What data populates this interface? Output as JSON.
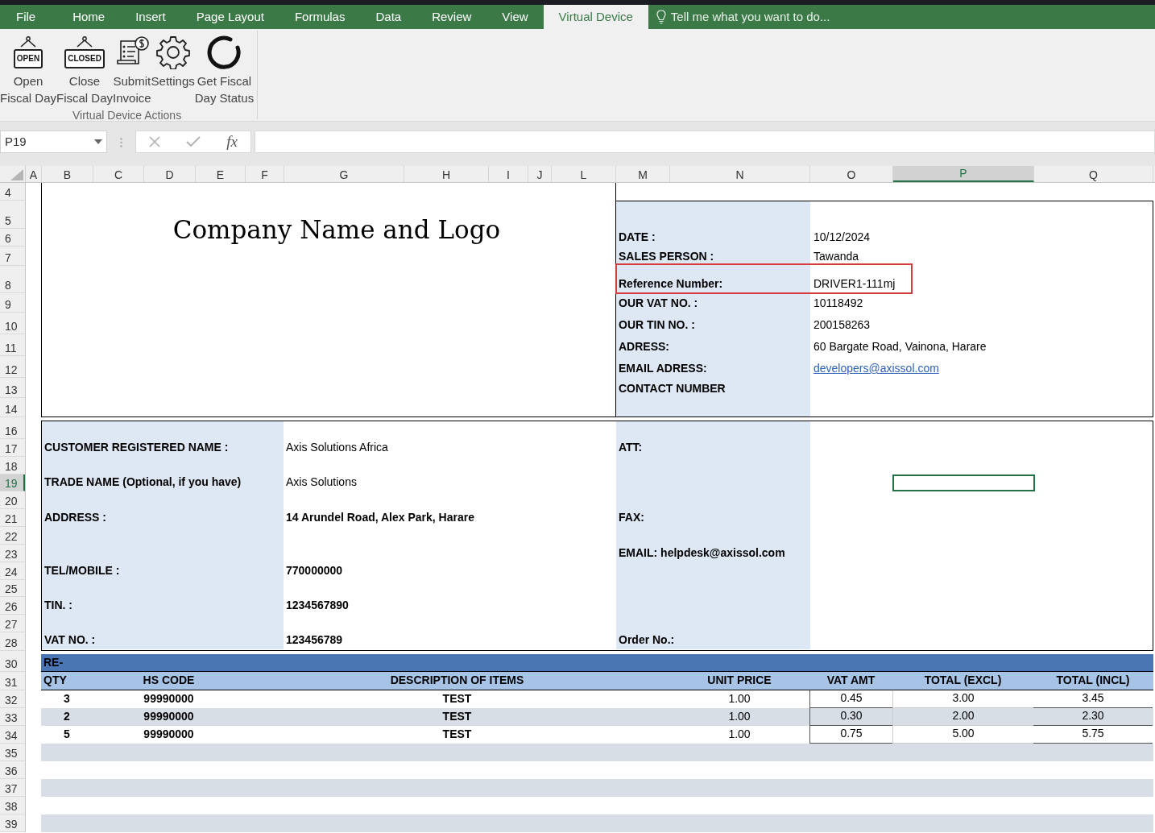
{
  "ribbon": {
    "tabs": [
      {
        "label": "File",
        "selected": false
      },
      {
        "label": "Home",
        "selected": false
      },
      {
        "label": "Insert",
        "selected": false
      },
      {
        "label": "Page Layout",
        "selected": false
      },
      {
        "label": "Formulas",
        "selected": false
      },
      {
        "label": "Data",
        "selected": false
      },
      {
        "label": "Review",
        "selected": false
      },
      {
        "label": "View",
        "selected": false
      },
      {
        "label": "Virtual Device",
        "selected": true
      }
    ],
    "tell_me": "Tell me what you want to do...",
    "buttons": [
      {
        "kind": "sign",
        "sign": "OPEN",
        "lines": [
          "Open",
          "Fiscal Day"
        ]
      },
      {
        "kind": "sign",
        "sign": "CLOSED",
        "lines": [
          "Close",
          "Fiscal Day"
        ]
      },
      {
        "kind": "invoice",
        "lines": [
          "Submit",
          "Invoice"
        ]
      },
      {
        "kind": "gear",
        "lines": [
          "Settings"
        ]
      },
      {
        "kind": "status",
        "lines": [
          "Get Fiscal",
          "Day Status"
        ]
      }
    ],
    "group_label": "Virtual Device Actions"
  },
  "formula_bar": {
    "name_box": "P19",
    "function_label": "fx"
  },
  "columns": [
    {
      "label": "A",
      "selected": false
    },
    {
      "label": "B",
      "selected": false
    },
    {
      "label": "C",
      "selected": false
    },
    {
      "label": "D",
      "selected": false
    },
    {
      "label": "E",
      "selected": false
    },
    {
      "label": "F",
      "selected": false
    },
    {
      "label": "G",
      "selected": false
    },
    {
      "label": "H",
      "selected": false
    },
    {
      "label": "I",
      "selected": false
    },
    {
      "label": "J",
      "selected": false
    },
    {
      "label": "L",
      "selected": false
    },
    {
      "label": "M",
      "selected": false
    },
    {
      "label": "N",
      "selected": false
    },
    {
      "label": "O",
      "selected": false
    },
    {
      "label": "P",
      "selected": true
    },
    {
      "label": "Q",
      "selected": false
    }
  ],
  "rows": [
    {
      "label": "4",
      "selected": false
    },
    {
      "label": "5",
      "selected": false
    },
    {
      "label": "6",
      "selected": false
    },
    {
      "label": "7",
      "selected": false
    },
    {
      "label": "8",
      "selected": false
    },
    {
      "label": "9",
      "selected": false
    },
    {
      "label": "10",
      "selected": false
    },
    {
      "label": "11",
      "selected": false
    },
    {
      "label": "12",
      "selected": false
    },
    {
      "label": "13",
      "selected": false
    },
    {
      "label": "14",
      "selected": false
    },
    {
      "label": "16",
      "selected": false
    },
    {
      "label": "17",
      "selected": false
    },
    {
      "label": "18",
      "selected": false
    },
    {
      "label": "19",
      "selected": true
    },
    {
      "label": "20",
      "selected": false
    },
    {
      "label": "21",
      "selected": false
    },
    {
      "label": "22",
      "selected": false
    },
    {
      "label": "23",
      "selected": false
    },
    {
      "label": "24",
      "selected": false
    },
    {
      "label": "25",
      "selected": false
    },
    {
      "label": "26",
      "selected": false
    },
    {
      "label": "27",
      "selected": false
    },
    {
      "label": "28",
      "selected": false
    },
    {
      "label": "30",
      "selected": false
    },
    {
      "label": "31",
      "selected": false
    },
    {
      "label": "32",
      "selected": false
    },
    {
      "label": "33",
      "selected": false
    },
    {
      "label": "34",
      "selected": false
    },
    {
      "label": "35",
      "selected": false
    },
    {
      "label": "36",
      "selected": false
    },
    {
      "label": "37",
      "selected": false
    },
    {
      "label": "38",
      "selected": false
    },
    {
      "label": "39",
      "selected": false
    }
  ],
  "header": {
    "company": "Company Name and Logo",
    "fields": [
      {
        "label": "DATE  :",
        "value": "10/12/2024",
        "kind": "text",
        "highlighted": false
      },
      {
        "label": "SALES PERSON  :",
        "value": "Tawanda",
        "kind": "text",
        "highlighted": false
      },
      {
        "label": "Reference Number:",
        "value": "DRIVER1-111mj",
        "kind": "text",
        "highlighted": true
      },
      {
        "label": "OUR VAT NO.  :",
        "value": "10118492",
        "kind": "text",
        "highlighted": false
      },
      {
        "label": "OUR TIN NO.  :",
        "value": "200158263",
        "kind": "text",
        "highlighted": false
      },
      {
        "label": "ADRESS:",
        "value": "60 Bargate Road, Vainona, Harare",
        "kind": "text",
        "highlighted": false
      },
      {
        "label": "EMAIL ADRESS:",
        "value": "developers@axissol.com",
        "kind": "link",
        "highlighted": false
      },
      {
        "label": "CONTACT NUMBER",
        "kind": "text",
        "highlighted": false
      }
    ]
  },
  "customer": {
    "lines": [
      {
        "kind": "blank",
        "selected": false
      },
      {
        "kind": "field",
        "label": "CUSTOMER REGISTERED NAME  :",
        "value": "Axis Solutions Africa",
        "value_bold": false,
        "right": "ATT:",
        "selected": false
      },
      {
        "kind": "blank",
        "selected": false
      },
      {
        "kind": "field",
        "label": "TRADE NAME (Optional, if you have)",
        "value": "Axis Solutions",
        "value_bold": false,
        "selected": true
      },
      {
        "kind": "blank",
        "selected": false
      },
      {
        "kind": "field",
        "label": "ADDRESS  :",
        "value": "14 Arundel Road, Alex Park, Harare",
        "value_bold": true,
        "right": "FAX:",
        "selected": false
      },
      {
        "kind": "blank",
        "selected": false
      },
      {
        "kind": "field",
        "right": "EMAIL: helpdesk@axissol.com",
        "selected": false
      },
      {
        "kind": "field",
        "label": "TEL/MOBILE  :",
        "value": "770000000",
        "value_bold": true,
        "selected": false
      },
      {
        "kind": "blank",
        "selected": false
      },
      {
        "kind": "field",
        "label": "TIN.  :",
        "value": "1234567890",
        "value_bold": true,
        "selected": false
      },
      {
        "kind": "blank",
        "selected": false
      },
      {
        "kind": "field",
        "label": "VAT NO.  :",
        "value": "123456789",
        "value_bold": true,
        "right": "Order No.:",
        "selected": false
      }
    ]
  },
  "items": {
    "title": "RE-",
    "columns": [
      "QTY",
      "HS CODE",
      "DESCRIPTION OF ITEMS",
      "UNIT PRICE",
      "VAT AMT",
      "TOTAL (EXCL)",
      "TOTAL (INCL)"
    ],
    "rows": [
      [
        "3",
        "99990000",
        "TEST",
        "1.00",
        "0.45",
        "3.00",
        "3.45"
      ],
      [
        "2",
        "99990000",
        "TEST",
        "1.00",
        "0.30",
        "2.00",
        "2.30"
      ],
      [
        "5",
        "99990000",
        "TEST",
        "1.00",
        "0.75",
        "5.00",
        "5.75"
      ]
    ]
  }
}
